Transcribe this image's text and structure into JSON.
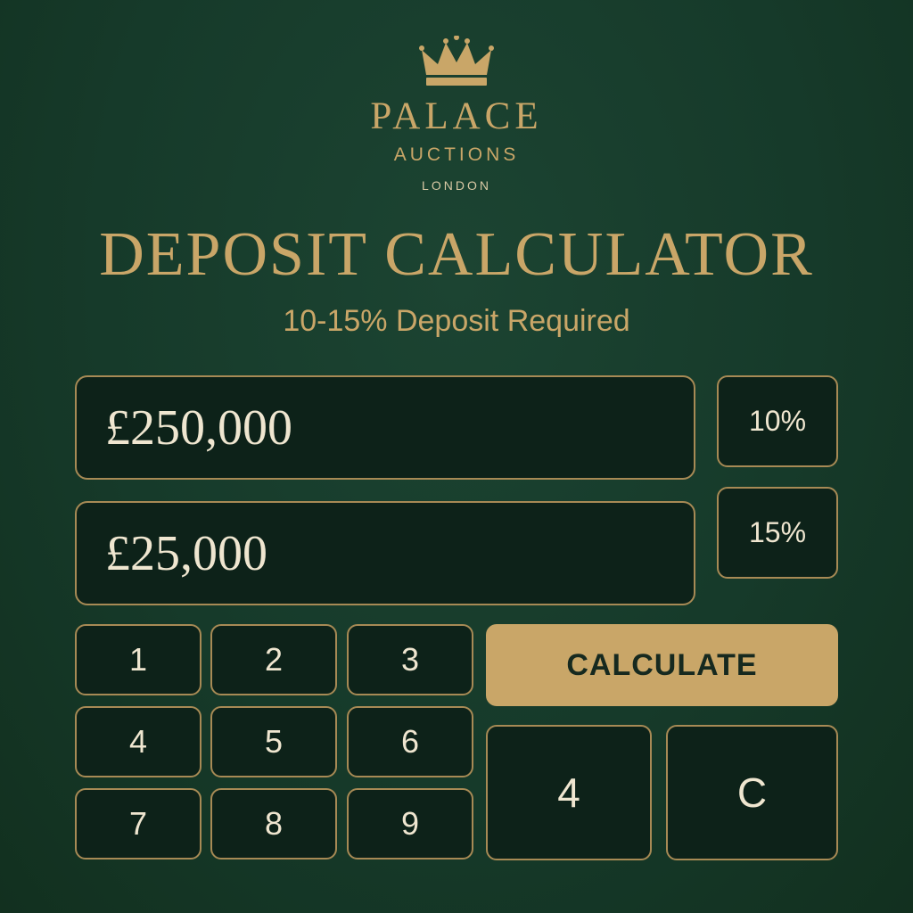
{
  "colors": {
    "background": "#163a2a",
    "gold": "#c9a668",
    "panel": "#0d2219",
    "border": "#a78a55",
    "text_light": "#efe6d0",
    "button_text_dark": "#16291f"
  },
  "brand": {
    "logo_icon": "crown-icon",
    "name": "PALACE",
    "sub": "AUCTIONS",
    "city": "LONDON"
  },
  "header": {
    "title": "DEPOSIT CALCULATOR",
    "subtitle": "10-15% Deposit Required"
  },
  "calculator": {
    "price_display": "£250,000",
    "deposit_display": "£25,000",
    "percent_options": [
      "10%",
      "15%"
    ],
    "keypad": [
      "1",
      "2",
      "3",
      "4",
      "5",
      "6",
      "7",
      "8",
      "9"
    ],
    "calculate_label": "CALCULATE",
    "extra_key": "4",
    "clear_label": "C"
  }
}
